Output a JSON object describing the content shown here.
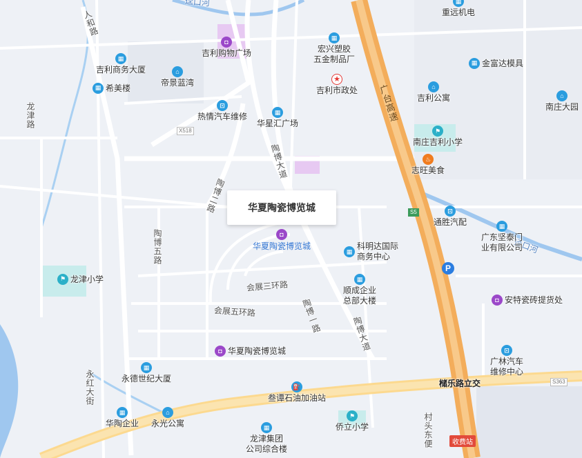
{
  "map": {
    "selected_place": {
      "callout_title": "华夏陶瓷博览城",
      "pin_label": "华夏陶瓷博览城",
      "pin_icon": "shopping-bag-icon"
    },
    "pois": [
      {
        "id": "zhongyuan",
        "label": "重远机电",
        "icon": "building-icon",
        "color": "blue"
      },
      {
        "id": "jili-mall",
        "label": "吉利购物广场",
        "icon": "shopping-bag-icon",
        "color": "purple"
      },
      {
        "id": "jili-business",
        "label": "吉利商务大厦",
        "icon": "building-icon",
        "color": "blue"
      },
      {
        "id": "ximei",
        "label": "希美楼",
        "icon": "building-icon",
        "color": "blue"
      },
      {
        "id": "dijing",
        "label": "帝景蓝湾",
        "icon": "residential-icon",
        "color": "blue"
      },
      {
        "id": "hongxing",
        "label": "宏兴塑胶\n五金制品厂",
        "icon": "building-icon",
        "color": "blue"
      },
      {
        "id": "jinfuda",
        "label": "金富达模具",
        "icon": "building-icon",
        "color": "blue"
      },
      {
        "id": "jili-gov",
        "label": "吉利市政处",
        "icon": "government-star-icon",
        "color": "red"
      },
      {
        "id": "jili-apt",
        "label": "吉利公寓",
        "icon": "residential-icon",
        "color": "blue"
      },
      {
        "id": "nanzhuang-garden",
        "label": "南庄大园",
        "icon": "residential-icon",
        "color": "blue"
      },
      {
        "id": "reqing",
        "label": "热情汽车维修",
        "icon": "car-icon",
        "color": "blue"
      },
      {
        "id": "huaxinghui",
        "label": "华星汇广场",
        "icon": "building-icon",
        "color": "blue"
      },
      {
        "id": "nanzhuang-school",
        "label": "南庄吉利小学",
        "icon": "school-flag-icon",
        "color": "teal"
      },
      {
        "id": "zhiwang",
        "label": "志旺美食",
        "icon": "restaurant-icon",
        "color": "orange"
      },
      {
        "id": "tongsheng",
        "label": "通胜汽配",
        "icon": "car-icon",
        "color": "blue"
      },
      {
        "id": "jiantai",
        "label": "广东坚泰门\n业有限公司",
        "icon": "building-icon",
        "color": "blue"
      },
      {
        "id": "kemingda",
        "label": "科明达国际\n商务中心",
        "icon": "building-icon",
        "color": "blue"
      },
      {
        "id": "longjin-school",
        "label": "龙津小学",
        "icon": "school-flag-icon",
        "color": "teal"
      },
      {
        "id": "shuncheng",
        "label": "顺成企业\n总部大楼",
        "icon": "building-icon",
        "color": "blue"
      },
      {
        "id": "ante",
        "label": "安特瓷砖提货处",
        "icon": "shopping-bag-icon",
        "color": "purple"
      },
      {
        "id": "huaxia-2",
        "label": "华夏陶瓷博览城",
        "icon": "shopping-bag-icon",
        "color": "purple"
      },
      {
        "id": "guanglin",
        "label": "广林汽车\n维修中心",
        "icon": "car-icon",
        "color": "blue"
      },
      {
        "id": "yongde",
        "label": "永德世纪大厦",
        "icon": "building-icon",
        "color": "blue"
      },
      {
        "id": "gas",
        "label": "叁谭石油加油站",
        "icon": "gas-station-icon",
        "color": "blue"
      },
      {
        "id": "huatao",
        "label": "华陶企业",
        "icon": "building-icon",
        "color": "blue"
      },
      {
        "id": "yongguang",
        "label": "永光公寓",
        "icon": "residential-icon",
        "color": "blue"
      },
      {
        "id": "qiaoli",
        "label": "侨立小学",
        "icon": "school-flag-icon",
        "color": "teal"
      },
      {
        "id": "longjin-group",
        "label": "龙津集团\n公司综合楼",
        "icon": "building-icon",
        "color": "blue"
      }
    ],
    "roads": [
      {
        "id": "renhe",
        "label": "人和路"
      },
      {
        "id": "longjin",
        "label": "龙津路"
      },
      {
        "id": "taobo-da-n",
        "label": "陶博大道"
      },
      {
        "id": "taobo-er",
        "label": "陶博二路"
      },
      {
        "id": "taobo-wu",
        "label": "陶博五路"
      },
      {
        "id": "huizhan-san",
        "label": "会展三环路"
      },
      {
        "id": "huizhan-wu",
        "label": "会展五环路"
      },
      {
        "id": "taobo-yi",
        "label": "陶博一路"
      },
      {
        "id": "taobo-da-s",
        "label": "陶博大道"
      },
      {
        "id": "yonghong",
        "label": "永红大街"
      },
      {
        "id": "guangtai",
        "label": "广台高速"
      },
      {
        "id": "cuntou",
        "label": "村头东便"
      },
      {
        "id": "river",
        "label": "迳口河"
      },
      {
        "id": "river-top",
        "label": "迳口河"
      }
    ],
    "shields": [
      {
        "id": "x518",
        "label": "X518"
      },
      {
        "id": "s5",
        "label": "S5"
      },
      {
        "id": "s363",
        "label": "S363"
      }
    ],
    "interchange": "槠乐路立交",
    "toll": "收费站",
    "parking": "P",
    "colors": {
      "highway": "#f5a955",
      "trunk": "#fcd98f",
      "water": "#9fc7ef",
      "pin": "#9b48c9",
      "selected_text": "#3a7bd5"
    }
  }
}
